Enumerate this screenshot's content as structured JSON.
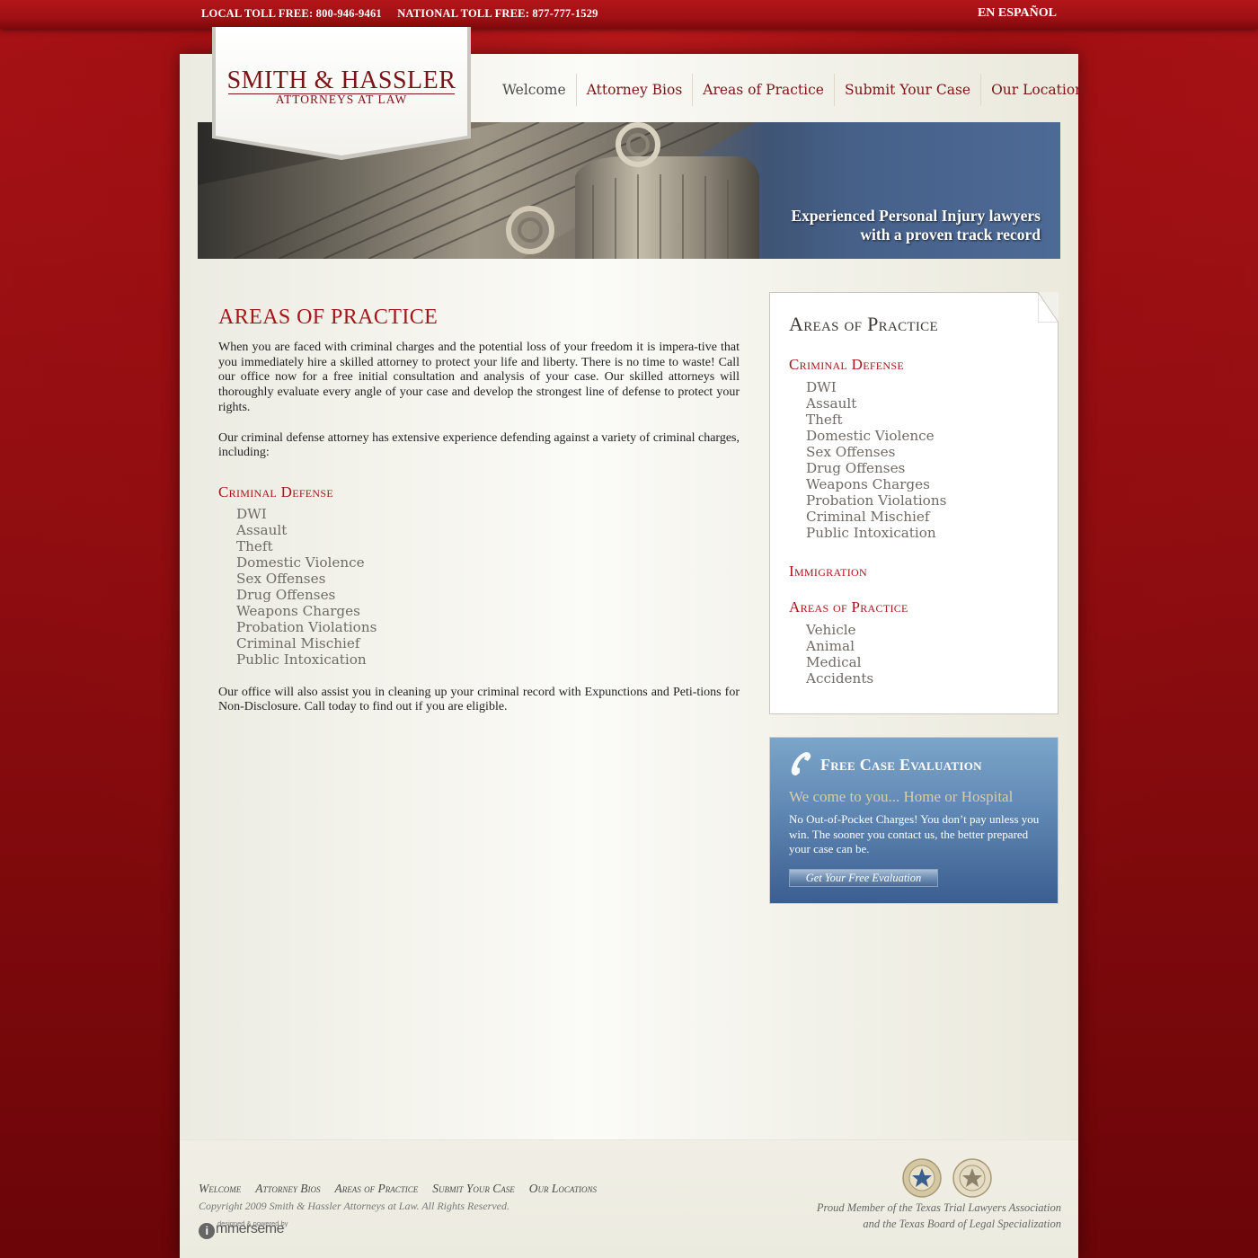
{
  "topbar": {
    "local_toll_free": "LOCAL TOLL FREE: 800-946-9461",
    "national_toll_free": "NATIONAL TOLL FREE: 877-777-1529",
    "espanol": "EN ESPAÑOL"
  },
  "logo": {
    "main": "SMITH & HASSLER",
    "sub": "ATTORNEYS AT LAW"
  },
  "nav": [
    "Welcome",
    "Attorney Bios",
    "Areas of Practice",
    "Submit Your Case",
    "Our Location"
  ],
  "banner": {
    "line1": "Experienced Personal Injury lawyers",
    "line2": "with a proven track record"
  },
  "main": {
    "heading": "AREAS OF PRACTICE",
    "para1": "When you are faced with criminal charges and the potential loss of your freedom it is impera-tive that you immediately hire a skilled attorney to protect your life and liberty. There is no time to waste! Call our office now for a free initial consultation and analysis of your case. Our skilled attorneys will thoroughly evaluate every angle of your case and develop the strongest line of defense to protect your rights.",
    "para2": "Our criminal defense attorney has extensive experience defending against a variety of criminal charges, including:",
    "section_heading": "Criminal Defense",
    "charges": [
      "DWI",
      "Assault",
      "Theft",
      "Domestic Violence",
      "Sex Offenses",
      "Drug Offenses",
      "Weapons Charges",
      "Probation Violations",
      "Criminal Mischief",
      "Public Intoxication"
    ],
    "para3": "Our office will also assist you in cleaning up your criminal record with Expunctions and Peti-tions for Non-Disclosure. Call today to find out if you are eligible."
  },
  "sidebar": {
    "title": "Areas of Practice",
    "criminal_heading": "Criminal Defense",
    "criminal_items": [
      "DWI",
      "Assault",
      "Theft",
      "Domestic Violence",
      "Sex Offenses",
      "Drug Offenses",
      "Weapons Charges",
      "Probation Violations",
      "Criminal Mischief",
      "Public Intoxication"
    ],
    "immigration_heading": "Immigration",
    "practice_heading": "Areas of Practice",
    "practice_items": [
      "Vehicle",
      "Animal",
      "Medical",
      "Accidents"
    ]
  },
  "evaluation": {
    "title": "Free Case Evaluation",
    "subtitle": "We come to you... Home or Hospital",
    "body": "No Out-of-Pocket Charges! You don’t pay unless you win. The sooner you contact us, the better prepared your case can be.",
    "button": "Get Your Free Evaluation"
  },
  "footer": {
    "nav": [
      "Welcome",
      "Attorney Bios",
      "Areas of Practice",
      "Submit Your Case",
      "Our Locations"
    ],
    "copyright": "Copyright 2009 Smith & Hassler Attorneys at Law. All Rights Reserved.",
    "credit_small": "designed & powered by",
    "credit_brand": "mmerseme",
    "credit_brand_initial": "i",
    "member_line1": "Proud Member of the Texas Trial Lawyers Association",
    "member_line2": "and the Texas Board of Legal Specialization"
  },
  "colors": {
    "brand_red": "#a5161b",
    "eval_blue": "#3b5e90",
    "background_red": "#8e0d10"
  }
}
